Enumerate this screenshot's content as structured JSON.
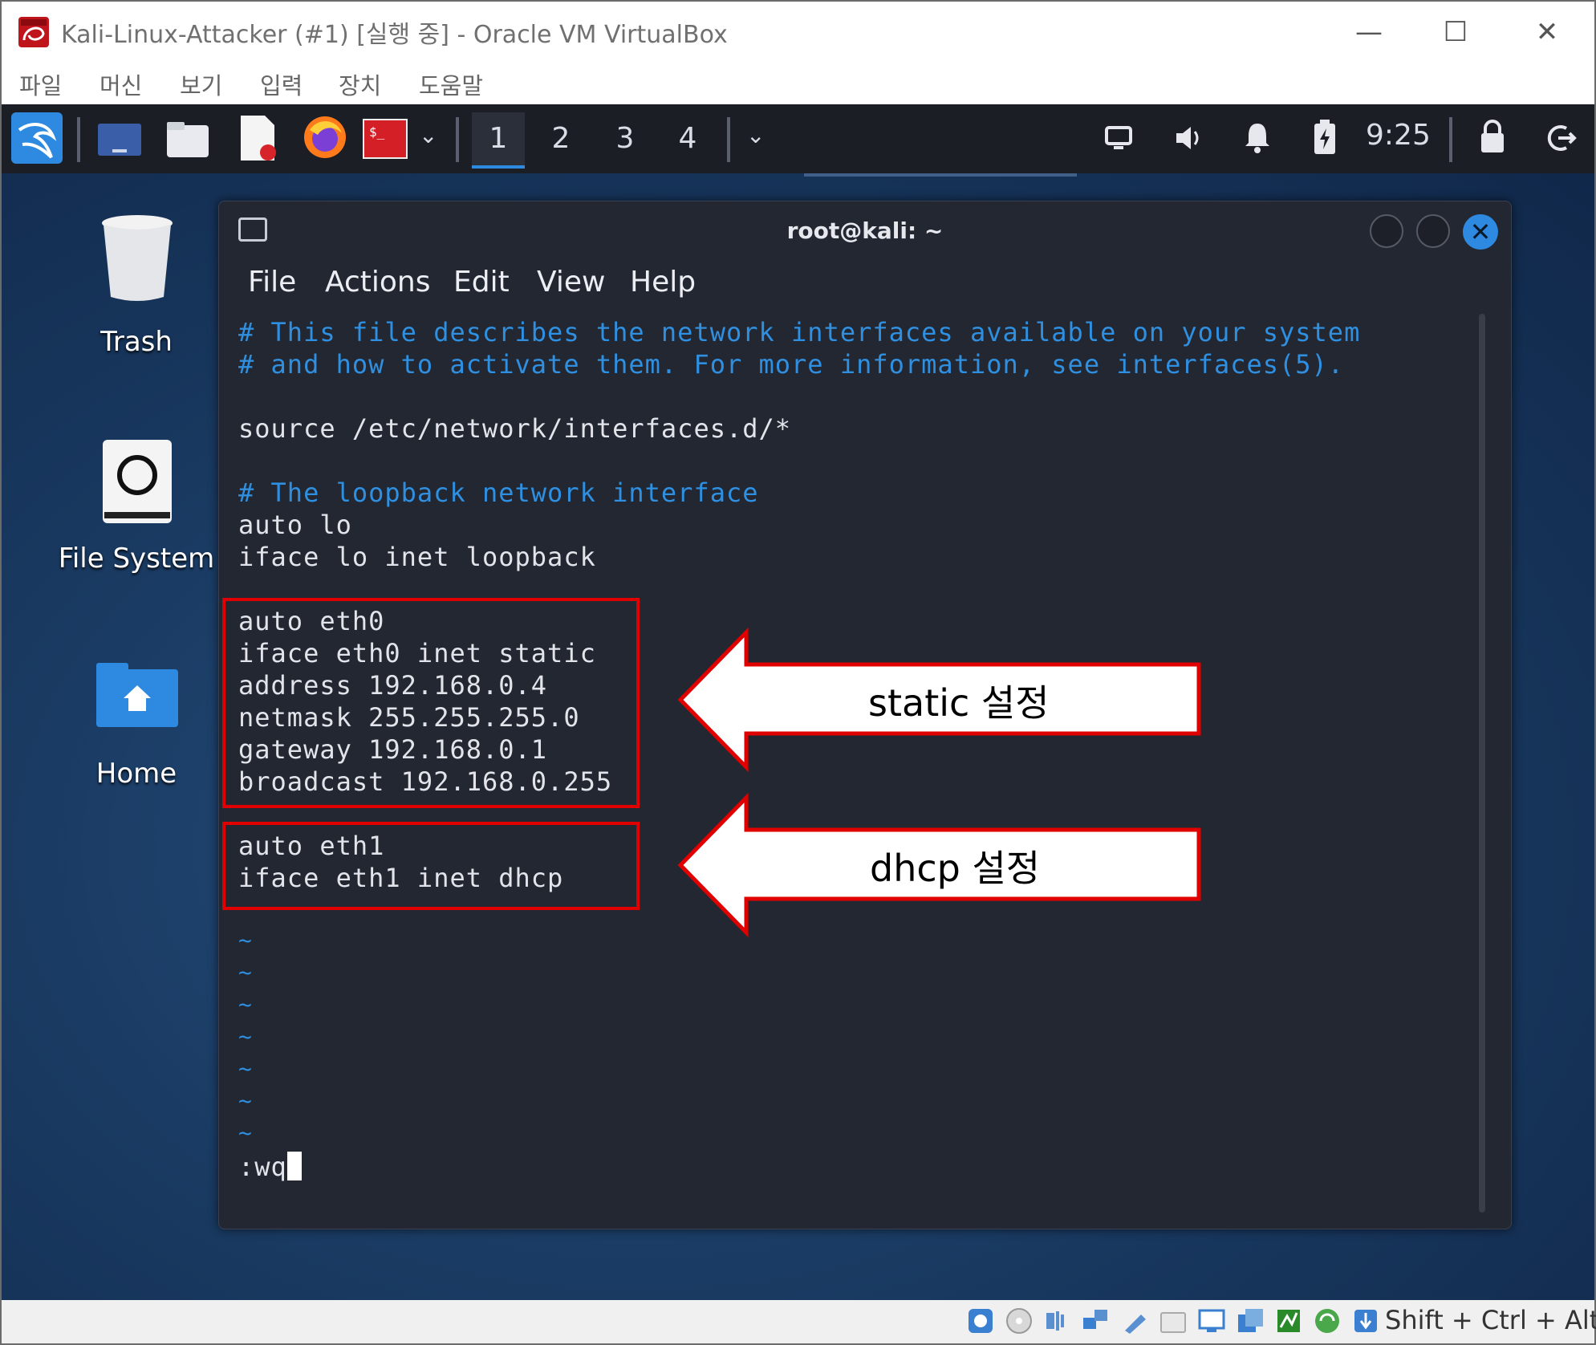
{
  "window": {
    "title": "Kali-Linux-Attacker (#1) [실행 중] - Oracle VM VirtualBox",
    "minimize": "—",
    "maximize": "☐",
    "close": "✕"
  },
  "menu": {
    "items": [
      "파일",
      "머신",
      "보기",
      "입력",
      "장치",
      "도움말"
    ]
  },
  "panel": {
    "workspaces": [
      "1",
      "2",
      "3",
      "4"
    ],
    "active_workspace": "1",
    "time": "9:25"
  },
  "desktop": {
    "icons": [
      {
        "label": "Trash"
      },
      {
        "label": "File System"
      },
      {
        "label": "Home"
      }
    ]
  },
  "terminal": {
    "title": "root@kali: ~",
    "menu": [
      "File",
      "Actions",
      "Edit",
      "View",
      "Help"
    ],
    "lines": [
      "# This file describes the network interfaces available on your system",
      "# and how to activate them. For more information, see interfaces(5).",
      "",
      "source /etc/network/interfaces.d/*",
      "",
      "# The loopback network interface",
      "auto lo",
      "iface lo inet loopback",
      "",
      "auto eth0",
      "iface eth0 inet static",
      "address 192.168.0.4",
      "netmask 255.255.255.0",
      "gateway 192.168.0.1",
      "broadcast 192.168.0.255",
      "",
      "auto eth1",
      "iface eth1 inet dhcp"
    ],
    "tildes": [
      "~",
      "~",
      "~",
      "~",
      "~",
      "~",
      "~"
    ],
    "command": ":wq"
  },
  "annotations": {
    "static_label": "static 설정",
    "dhcp_label": "dhcp 설정",
    "box_color": "#e00000"
  },
  "statusbar": {
    "host_keys": "Shift + Ctrl + Alt"
  },
  "colors": {
    "comment": "#2f8fe0",
    "terminal_bg": "#232731",
    "panel_bg": "#1b1e25",
    "accent": "#2d8ae0"
  }
}
